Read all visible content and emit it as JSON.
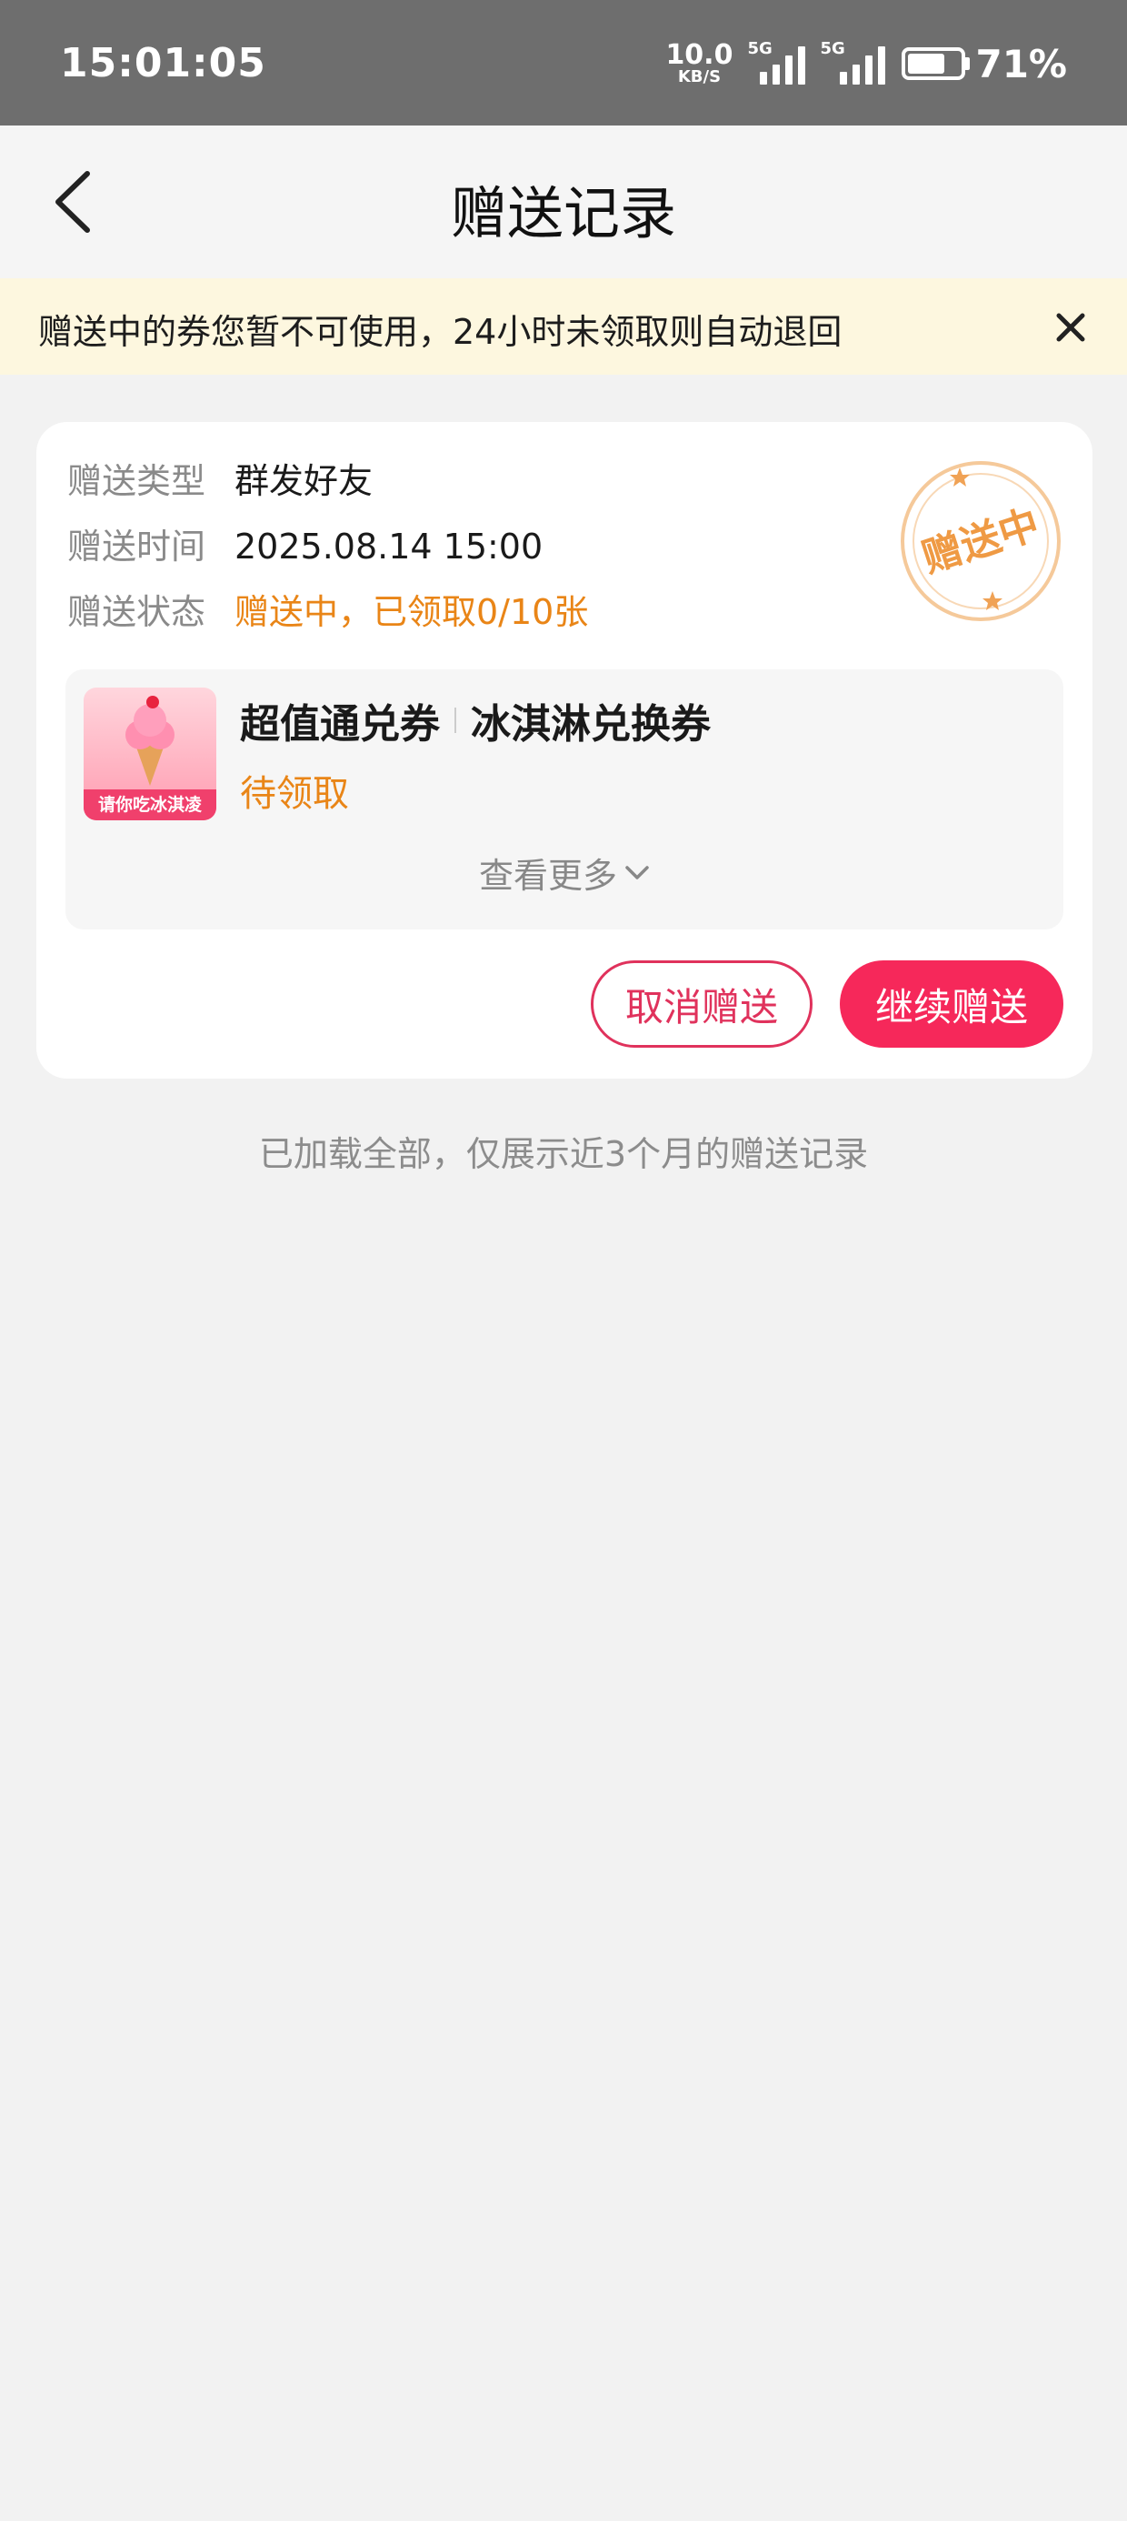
{
  "status_bar": {
    "time": "15:01:05",
    "net_speed": "10.0",
    "net_unit": "KB/S",
    "signal1_tag": "5G",
    "signal2_tag": "5G",
    "battery_level": 0.71,
    "battery_pct": "71%"
  },
  "nav": {
    "title": "赠送记录",
    "back_icon": "chevron-left-icon"
  },
  "notice": {
    "text": "赠送中的券您暂不可使用，24小时未领取则自动退回",
    "close_icon": "close-icon"
  },
  "record": {
    "type_label": "赠送类型",
    "type_value": "群发好友",
    "time_label": "赠送时间",
    "time_value": "2025.08.14 15:00",
    "status_label": "赠送状态",
    "status_value": "赠送中，已领取0/10张",
    "stamp_text": "赠送中",
    "coupon": {
      "image_caption": "请你吃冰淇凌",
      "category": "超值通兑券",
      "name": "冰淇淋兑换券",
      "status": "待领取"
    },
    "view_more": "查看更多",
    "cancel_button": "取消赠送",
    "continue_button": "继续赠送"
  },
  "footer": {
    "text": "已加载全部，仅展示近3个月的赠送记录"
  },
  "colors": {
    "accent_orange": "#e98517",
    "accent_pink": "#f6285a",
    "notice_bg": "#fdf7df",
    "page_bg": "#f2f2f2"
  }
}
